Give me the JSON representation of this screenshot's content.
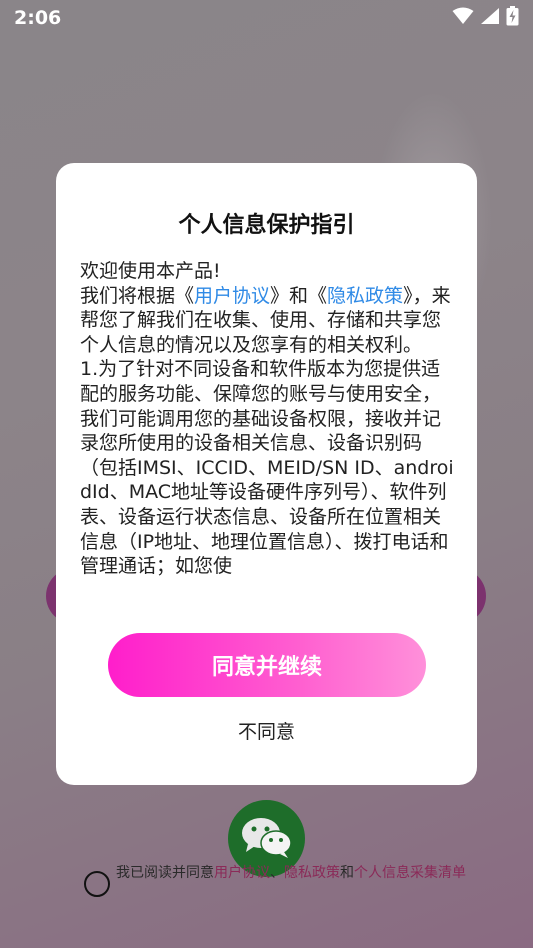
{
  "status_bar": {
    "time": "2:06",
    "icons": [
      "wifi-icon",
      "signal-icon",
      "battery-charging-icon"
    ]
  },
  "dialog": {
    "title": "个人信息保护指引",
    "welcome": "欢迎使用本产品!",
    "intro_prefix": "我们将根据《",
    "link_user_agreement": "用户协议",
    "intro_mid": "》和《",
    "link_privacy_policy": "隐私政策",
    "intro_suffix": "》，来帮您了解我们在收集、使用、存储和共享您个人信息的情况以及您享有的相关权利。",
    "item1": "1.为了针对不同设备和软件版本为您提供适配的服务功能、保障您的账号与使用安全，我们可能调用您的基础设备权限，接收并记录您所使用的设备相关信息、设备识别码（包括IMSI、ICCID、MEID/SN ID、androidId、MAC地址等设备硬件序列号）、软件列表、设备运行状态信息、设备所在位置相关信息（IP地址、地理位置信息）、拨打电话和管理通话；如您使",
    "agree_button": "同意并继续",
    "disagree_button": "不同意"
  },
  "background": {
    "agree_prefix": "我已阅读并同意",
    "agree_link_user": "用户协议",
    "agree_sep": "、",
    "agree_link_privacy": "隐私政策",
    "agree_and": "和",
    "agree_link_personal": "个人信息采集清单"
  },
  "colors": {
    "link": "#2f8ae6",
    "accent_start": "#ff1ecb",
    "accent_end": "#ff90da"
  }
}
